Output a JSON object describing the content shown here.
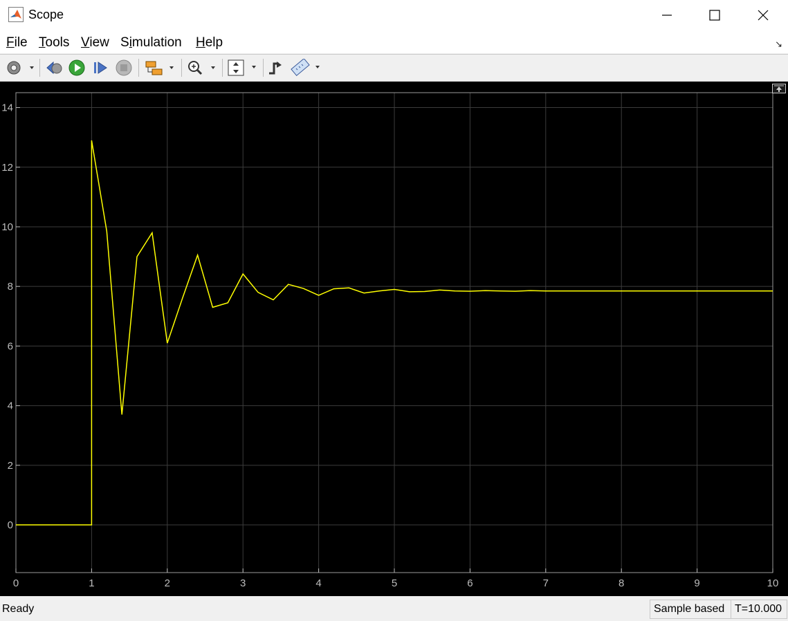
{
  "window": {
    "title": "Scope"
  },
  "menu": [
    {
      "label": "File",
      "mnemonic": "F",
      "rest": "ile"
    },
    {
      "label": "Tools",
      "mnemonic": "T",
      "rest": "ools"
    },
    {
      "label": "View",
      "mnemonic": "V",
      "rest": "iew"
    },
    {
      "label": "Simulation",
      "pre": "S",
      "mnemonic": "i",
      "rest": "mulation"
    },
    {
      "label": "Help",
      "mnemonic": "H",
      "rest": "elp"
    }
  ],
  "toolbar": {
    "icons": [
      "gear-icon",
      "step-back-icon",
      "run-icon",
      "step-forward-icon",
      "stop-icon",
      "highlight-block-icon",
      "zoom-icon",
      "fit-axes-icon",
      "triggers-icon",
      "measurements-icon"
    ]
  },
  "status": {
    "left": "Ready",
    "mode": "Sample based",
    "time": "T=10.000"
  },
  "chart_data": {
    "type": "line",
    "xlim": [
      0,
      10
    ],
    "ylim": [
      -1.6,
      14.5
    ],
    "xticks": [
      0,
      1,
      2,
      3,
      4,
      5,
      6,
      7,
      8,
      9,
      10
    ],
    "yticks": [
      0,
      2,
      4,
      6,
      8,
      10,
      12,
      14
    ],
    "grid": true,
    "background": "#000000",
    "line_color": "#ffff00",
    "grid_color": "#3c3c3c",
    "series": [
      {
        "x": [
          0,
          1,
          1,
          1.2,
          1.4,
          1.6,
          1.8,
          2.0,
          2.2,
          2.4,
          2.6,
          2.8,
          3.0,
          3.2,
          3.4,
          3.6,
          3.8,
          4.0,
          4.2,
          4.4,
          4.6,
          4.8,
          5.0,
          5.2,
          5.4,
          5.6,
          5.8,
          6.0,
          6.2,
          6.4,
          6.6,
          6.8,
          7.0,
          7.5,
          8.0,
          9.0,
          10.0
        ],
        "y": [
          0,
          0,
          12.9,
          9.85,
          3.7,
          9.0,
          9.8,
          6.1,
          7.6,
          9.05,
          7.3,
          7.45,
          8.42,
          7.8,
          7.55,
          8.07,
          7.93,
          7.7,
          7.92,
          7.95,
          7.78,
          7.85,
          7.9,
          7.82,
          7.83,
          7.88,
          7.85,
          7.84,
          7.86,
          7.85,
          7.84,
          7.86,
          7.85,
          7.85,
          7.85,
          7.85,
          7.85
        ]
      }
    ]
  }
}
